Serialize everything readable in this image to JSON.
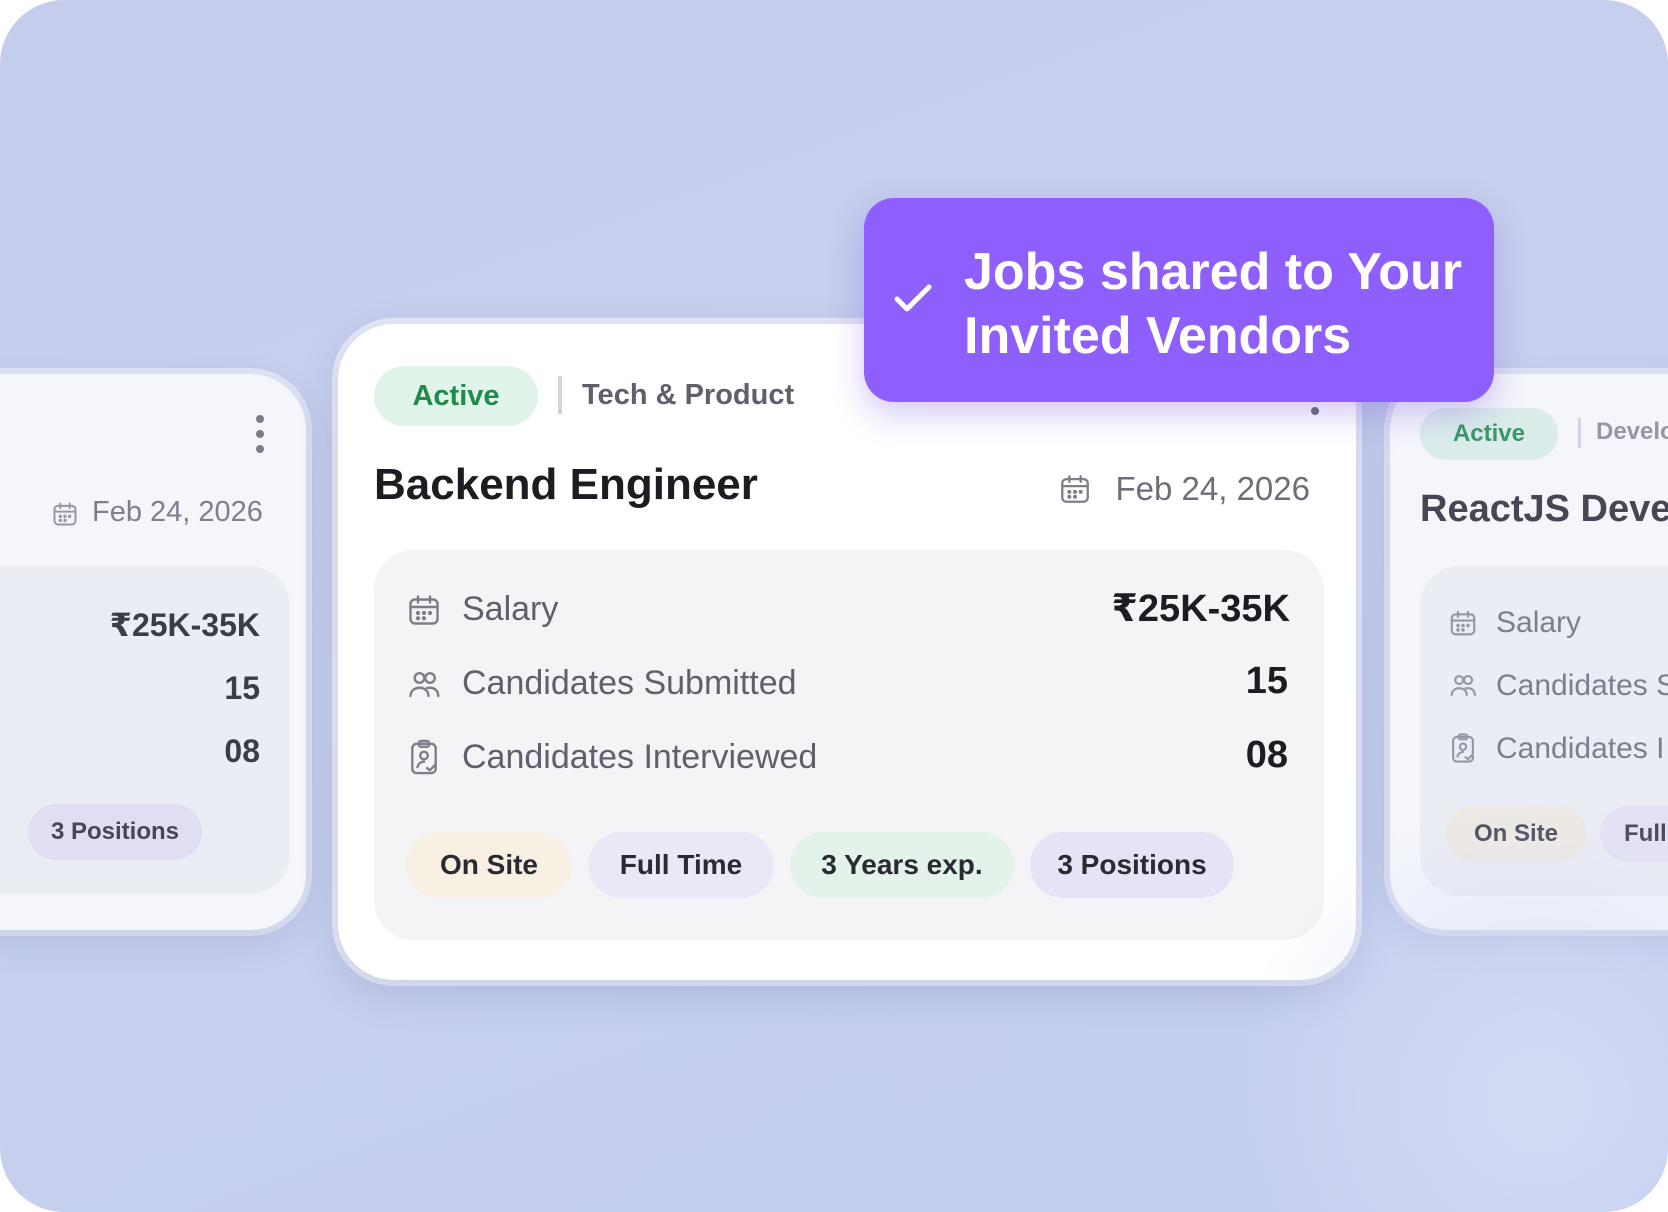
{
  "colors": {
    "background": "#c6cfed",
    "banner": "#8f5ffd",
    "active_green": "#1f8a4c",
    "card": "#ffffff"
  },
  "left_card": {
    "date": "Feb 24, 2026",
    "salary_value": "₹25K-35K",
    "submitted_value": "15",
    "interviewed_value": "08",
    "tags": {
      "positions": "3 Positions"
    },
    "menu_icon": "more-vertical-icon"
  },
  "main_card": {
    "status": "Active",
    "category": "Tech & Product",
    "title": "Backend Engineer",
    "date": "Feb 24, 2026",
    "stats": {
      "salary_label": "Salary",
      "salary_value": "₹25K-35K",
      "submitted_label": "Candidates Submitted",
      "submitted_value": "15",
      "interviewed_label": "Candidates Interviewed",
      "interviewed_value": "08"
    },
    "tags": {
      "onsite": "On Site",
      "fulltime": "Full Time",
      "years": "3 Years exp.",
      "positions": "3 Positions"
    }
  },
  "right_card": {
    "status": "Active",
    "category": "Develo",
    "title": "ReactJS Deve",
    "stats": {
      "salary_label": "Salary",
      "submitted_label": "Candidates S",
      "interviewed_label": "Candidates I"
    },
    "tags": {
      "onsite": "On Site",
      "fulltime": "Full"
    }
  },
  "banner": {
    "text": "Jobs shared to Your Invited Vendors",
    "icon": "check-icon"
  }
}
